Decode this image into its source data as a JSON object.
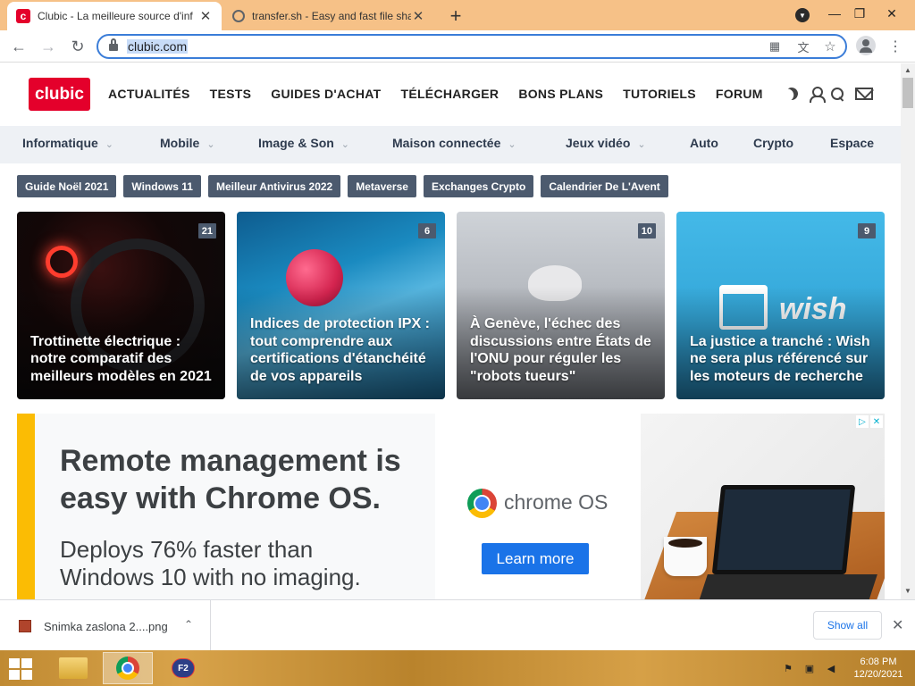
{
  "browser": {
    "tabs": [
      {
        "title": "Clubic - La meilleure source d'inf",
        "active": true,
        "favicon": "clubic-favicon"
      },
      {
        "title": "transfer.sh - Easy and fast file sha",
        "active": false,
        "favicon": "globe-icon"
      }
    ],
    "new_tab_label": "+",
    "close_glyph": "✕",
    "window_controls": {
      "minimize": "—",
      "maximize": "❐",
      "close": "✕"
    },
    "url": "clubic.com"
  },
  "site": {
    "logo": "clubic",
    "brand_color": "#e4002b",
    "main_nav": [
      "ACTUALITÉS",
      "TESTS",
      "GUIDES D'ACHAT",
      "TÉLÉCHARGER",
      "BONS PLANS",
      "TUTORIELS",
      "FORUM"
    ],
    "categories": [
      {
        "label": "Informatique",
        "has_dropdown": true
      },
      {
        "label": "Mobile",
        "has_dropdown": true
      },
      {
        "label": "Image & Son",
        "has_dropdown": true
      },
      {
        "label": "Maison connectée",
        "has_dropdown": true
      },
      {
        "label": "Jeux vidéo",
        "has_dropdown": true
      },
      {
        "label": "Auto",
        "has_dropdown": false
      },
      {
        "label": "Crypto",
        "has_dropdown": false
      },
      {
        "label": "Espace",
        "has_dropdown": false
      }
    ],
    "tags": [
      "Guide Noël 2021",
      "Windows 11",
      "Meilleur Antivirus 2022",
      "Metaverse",
      "Exchanges Crypto",
      "Calendrier De L'Avent"
    ],
    "cards": [
      {
        "title": "Trottinette électrique : notre comparatif des meilleurs modèles en 2021",
        "comments": "21"
      },
      {
        "title": "Indices de protection IPX : tout comprendre aux certifications d'étanchéité de vos appareils",
        "comments": "6"
      },
      {
        "title": "À Genève, l'échec des discussions entre États de l'ONU pour réguler les \"robots tueurs\"",
        "comments": "10"
      },
      {
        "title": "La justice a tranché : Wish ne sera plus référencé sur les moteurs de recherche",
        "comments": "9"
      }
    ],
    "card_image_text": {
      "wish_logo": "wish"
    }
  },
  "ad": {
    "headline_line1": "Remote management is",
    "headline_line2": "easy with Chrome OS.",
    "sub_line1": "Deploys 76% faster than",
    "sub_line2": "Windows 10 with no imaging.",
    "product": "chrome OS",
    "cta": "Learn more",
    "adchoices_icons": [
      "▷",
      "✕"
    ],
    "accent": "#fbbc04",
    "cta_color": "#1a73e8"
  },
  "downloads": {
    "file_name": "Snimka zaslona 2....png",
    "show_all": "Show all",
    "caret": "⌃",
    "close": "✕"
  },
  "taskbar": {
    "apps": [
      "file-explorer-icon",
      "chrome-icon",
      "f2-app-icon"
    ],
    "f2_label": "F2",
    "time": "6:08 PM",
    "date": "12/20/2021"
  }
}
